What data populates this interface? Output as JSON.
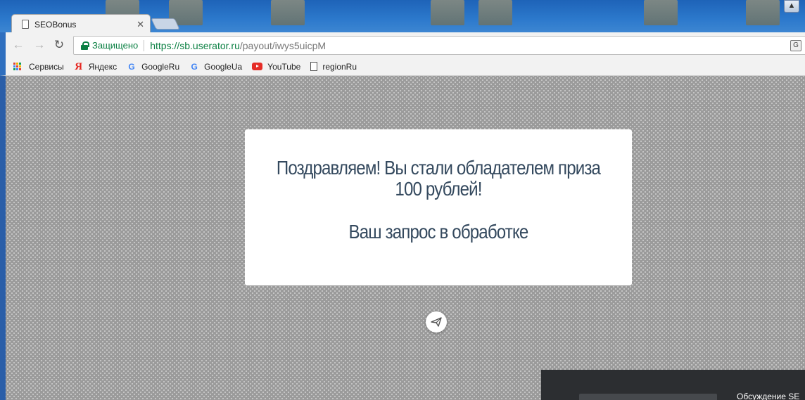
{
  "browser": {
    "tab": {
      "title": "SEOBonus"
    },
    "address": {
      "secure_label": "Защищено",
      "url_host": "https://sb.userator.ru",
      "url_path": "/payout/iwys5uicpM"
    },
    "bookmarks": [
      {
        "label": "Сервисы",
        "icon": "apps-icon"
      },
      {
        "label": "Яндекс",
        "icon": "yandex-icon"
      },
      {
        "label": "GoogleRu",
        "icon": "google-icon"
      },
      {
        "label": "GoogleUa",
        "icon": "google-icon"
      },
      {
        "label": "YouTube",
        "icon": "youtube-icon"
      },
      {
        "label": "regionRu",
        "icon": "page-icon"
      }
    ]
  },
  "page": {
    "message_line1": "Поздравляем! Вы стали обладателем приза",
    "message_line2": "100 рублей!",
    "status": "Ваш запрос в обработке",
    "chat_title": "Обсуждение SE",
    "colors": {
      "text": "#34495e",
      "secure": "#0b8043",
      "background": "#9a9a9a"
    }
  }
}
